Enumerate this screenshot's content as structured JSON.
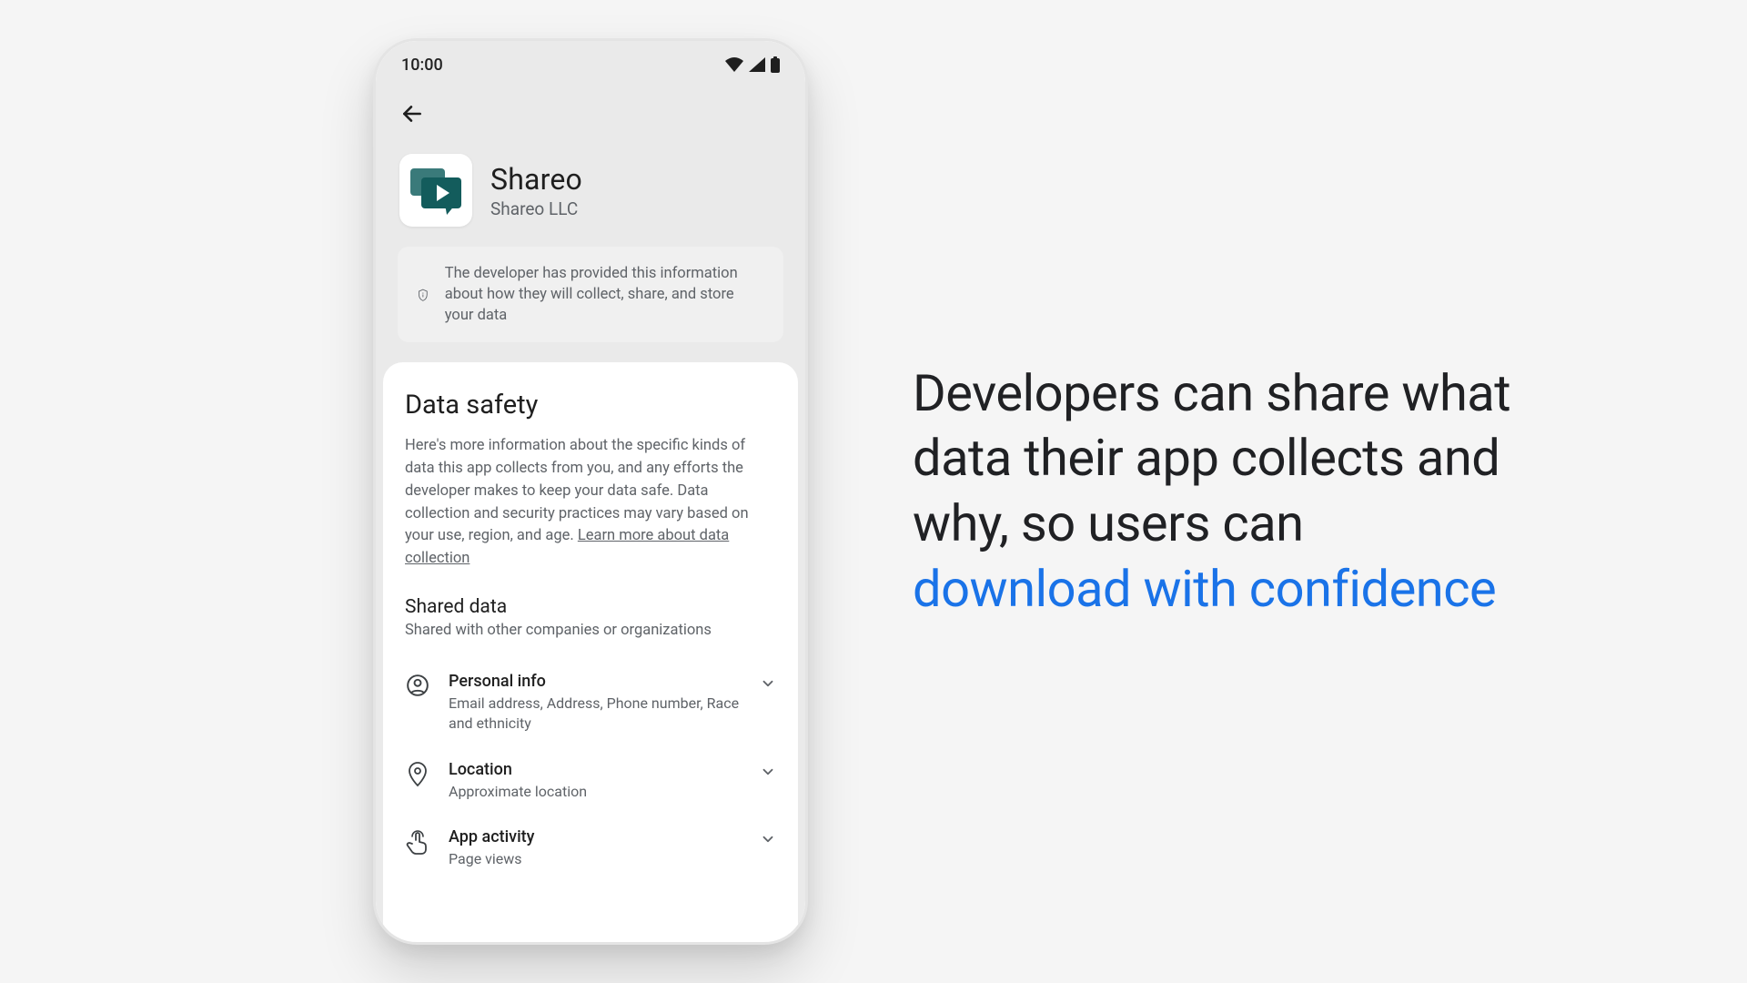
{
  "status": {
    "time": "10:00"
  },
  "app": {
    "name": "Shareo",
    "developer": "Shareo LLC"
  },
  "infobox": {
    "text": "The developer has provided this information about how they will collect, share, and store your data"
  },
  "datasafety": {
    "heading": "Data safety",
    "description_prefix": "Here's more information about the specific kinds of data this app collects from you, and any efforts the developer makes to keep your data safe. Data collection and security practices may vary based on your use, region, and age. ",
    "learn_more": "Learn more about data collection",
    "shared_heading": "Shared data",
    "shared_sub": "Shared with other companies or organizations",
    "rows": [
      {
        "title": "Personal info",
        "sub": "Email address, Address, Phone number, Race and ethnicity"
      },
      {
        "title": "Location",
        "sub": "Approximate location"
      },
      {
        "title": "App activity",
        "sub": "Page views"
      }
    ]
  },
  "marketing": {
    "line_plain": "Developers can share what data their app collects and why, so users can ",
    "line_accent": "download with confidence"
  }
}
